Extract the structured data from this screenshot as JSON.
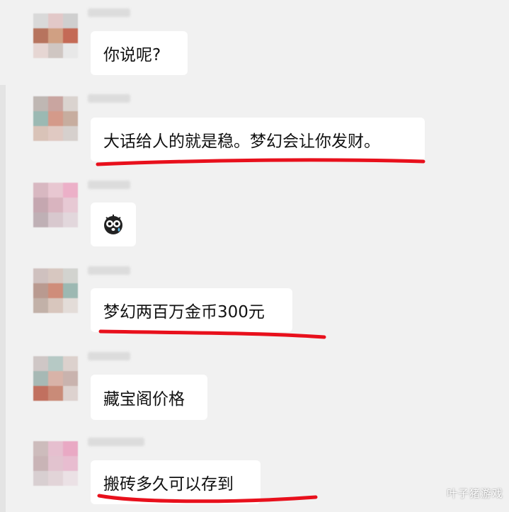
{
  "chat": {
    "messages": [
      {
        "text": "你说呢?",
        "emoji": "",
        "avatar": [
          "#d9d9d9",
          "#e2c8c8",
          "#cfcfcf",
          "#b7745e",
          "#d0a083",
          "#c46a56",
          "#e6d6d3",
          "#cfc6c2",
          "#e8e8e8"
        ],
        "underlined": false
      },
      {
        "text": "大话给人的就是稳。梦幻会让你发财。",
        "emoji": "",
        "avatar": [
          "#bfb7b3",
          "#c9a5a0",
          "#dad3cf",
          "#9bb9b3",
          "#d49a8a",
          "#c7ad9f",
          "#d9c3b8",
          "#e0c9c2",
          "#d6d0cd"
        ],
        "underlined": true
      },
      {
        "text": "",
        "emoji": "🙀",
        "avatar": [
          "#d8b8c1",
          "#e8c7d1",
          "#ecb0c8",
          "#c5a7b0",
          "#d9b4bf",
          "#e7c9d4",
          "#bfb0b5",
          "#d8c8ce",
          "#e2d7dc"
        ],
        "underlined": false
      },
      {
        "text": "梦幻两百万金币300元",
        "emoji": "",
        "avatar": [
          "#cfc1bf",
          "#d7c7c0",
          "#d2d3cf",
          "#b99a90",
          "#cf8d7a",
          "#9cb8b2",
          "#c2b1a8",
          "#d8c6bd",
          "#e3dcd8"
        ],
        "underlined": true
      },
      {
        "text": "藏宝阁价格",
        "emoji": "",
        "avatar": [
          "#cfc7c6",
          "#b6c9c5",
          "#dcd1cd",
          "#a7b9b5",
          "#d8b3a8",
          "#c9b3ae",
          "#c1705f",
          "#c98b78",
          "#ddd2cf"
        ],
        "underlined": false
      },
      {
        "text": "搬砖多久可以存到",
        "emoji": "",
        "avatar": [
          "#cdbcbc",
          "#e6bfcf",
          "#e9a9c4",
          "#c9b4b6",
          "#e2c3cf",
          "#e8bdd0",
          "#d8cfd1",
          "#e2d4d8",
          "#ebe1e5"
        ],
        "underlined": true
      }
    ]
  },
  "watermark": "叶子猪游戏",
  "colors": {
    "background": "#f1f1f1",
    "bubble": "#ffffff",
    "underline": "#e8101c"
  }
}
